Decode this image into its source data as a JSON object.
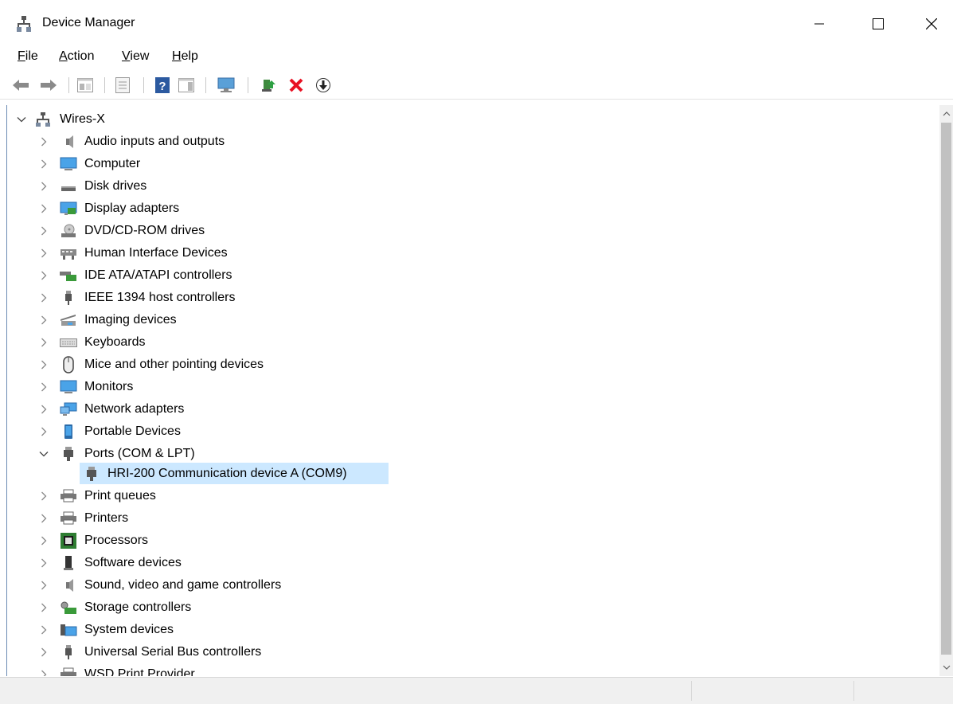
{
  "window": {
    "title": "Device Manager"
  },
  "menu": [
    {
      "label": "File",
      "u": "F",
      "rest": "ile"
    },
    {
      "label": "Action",
      "u": "A",
      "rest": "ction"
    },
    {
      "label": "View",
      "u": "V",
      "rest": "iew"
    },
    {
      "label": "Help",
      "u": "H",
      "rest": "elp"
    }
  ],
  "tree": {
    "root": "Wires-X",
    "categories": [
      "Audio inputs and outputs",
      "Computer",
      "Disk drives",
      "Display adapters",
      "DVD/CD-ROM drives",
      "Human Interface Devices",
      "IDE ATA/ATAPI controllers",
      "IEEE 1394 host controllers",
      "Imaging devices",
      "Keyboards",
      "Mice and other pointing devices",
      "Monitors",
      "Network adapters",
      "Portable Devices",
      "Ports (COM & LPT)",
      "Print queues",
      "Printers",
      "Processors",
      "Software devices",
      "Sound, video and game controllers",
      "Storage controllers",
      "System devices",
      "Universal Serial Bus controllers",
      "WSD Print Provider"
    ],
    "ports_child": "HRI-200 Communication device A (COM9)"
  },
  "colors": {
    "selection": "#cce8ff",
    "delete": "#e81123"
  }
}
